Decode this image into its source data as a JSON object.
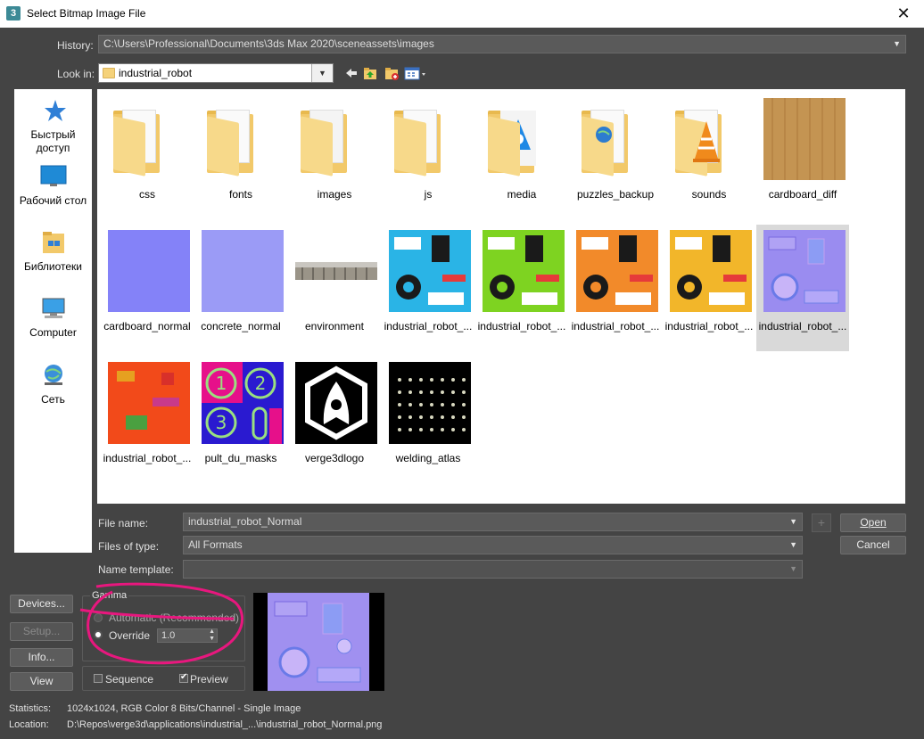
{
  "window": {
    "title": "Select Bitmap Image File",
    "app_icon": "3",
    "close_glyph": "✕"
  },
  "history": {
    "label": "History:",
    "value": "C:\\Users\\Professional\\Documents\\3ds Max 2020\\sceneassets\\images"
  },
  "lookin": {
    "label": "Look in:",
    "value": "industrial_robot"
  },
  "places": [
    {
      "label": "Быстрый доступ",
      "icon": "star-icon"
    },
    {
      "label": "Рабочий стол",
      "icon": "desktop-icon"
    },
    {
      "label": "Библиотеки",
      "icon": "libraries-icon"
    },
    {
      "label": "Computer",
      "icon": "computer-icon"
    },
    {
      "label": "Сеть",
      "icon": "network-icon"
    }
  ],
  "files": [
    {
      "name": "css",
      "kind": "folder"
    },
    {
      "name": "fonts",
      "kind": "folder"
    },
    {
      "name": "images",
      "kind": "folder"
    },
    {
      "name": "js",
      "kind": "folder"
    },
    {
      "name": "media",
      "kind": "folder"
    },
    {
      "name": "puzzles_backup",
      "kind": "folder"
    },
    {
      "name": "sounds",
      "kind": "folder"
    },
    {
      "name": "cardboard_diff",
      "kind": "image"
    },
    {
      "name": "cardboard_normal",
      "kind": "image"
    },
    {
      "name": "concrete_normal",
      "kind": "image"
    },
    {
      "name": "environment",
      "kind": "image"
    },
    {
      "name": "industrial_robot_...",
      "kind": "image"
    },
    {
      "name": "industrial_robot_...",
      "kind": "image"
    },
    {
      "name": "industrial_robot_...",
      "kind": "image"
    },
    {
      "name": "industrial_robot_...",
      "kind": "image"
    },
    {
      "name": "industrial_robot_...",
      "kind": "image",
      "selected": true
    },
    {
      "name": "industrial_robot_...",
      "kind": "image"
    },
    {
      "name": "pult_du_masks",
      "kind": "image"
    },
    {
      "name": "verge3dlogo",
      "kind": "image"
    },
    {
      "name": "welding_atlas",
      "kind": "image"
    }
  ],
  "form": {
    "filename_label": "File name:",
    "filename_value": "industrial_robot_Normal",
    "filetype_label": "Files of type:",
    "filetype_value": "All Formats",
    "template_label": "Name template:",
    "template_value": "",
    "plus": "+"
  },
  "buttons": {
    "open": "Open",
    "cancel": "Cancel",
    "devices": "Devices...",
    "setup": "Setup...",
    "info": "Info...",
    "view": "View"
  },
  "gamma": {
    "title": "Gamma",
    "automatic": "Automatic (Recommended)",
    "override": "Override",
    "override_value": "1.0",
    "selected": "override"
  },
  "options": {
    "sequence": "Sequence",
    "sequence_checked": false,
    "preview": "Preview",
    "preview_checked": true
  },
  "status": {
    "statistics_label": "Statistics:",
    "statistics_value": "1024x1024, RGB Color 8 Bits/Channel - Single Image",
    "location_label": "Location:",
    "location_value": "D:\\Repos\\verge3d\\applications\\industrial_...\\industrial_robot_Normal.png"
  },
  "colors": {
    "annotation": "#e8177e",
    "accent": "#ffffff",
    "background": "#444444"
  }
}
